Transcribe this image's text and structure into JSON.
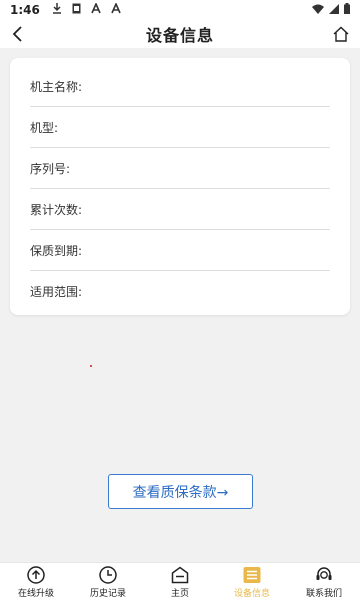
{
  "status_bar": {
    "time": "1:46",
    "icons": [
      "download-icon",
      "sim-icon",
      "a-icon",
      "a-icon"
    ],
    "right_icons": [
      "wifi-icon",
      "signal-icon",
      "battery-icon"
    ]
  },
  "header": {
    "title": "设备信息",
    "back_icon": "chevron-left-icon",
    "home_icon": "home-icon"
  },
  "device_info": {
    "rows": [
      {
        "label": "机主名称:",
        "value": ""
      },
      {
        "label": "机型:",
        "value": ""
      },
      {
        "label": "序列号:",
        "value": ""
      },
      {
        "label": "累计次数:",
        "value": ""
      },
      {
        "label": "保质到期:",
        "value": ""
      },
      {
        "label": "适用范围:",
        "value": ""
      }
    ]
  },
  "warranty_button": {
    "label": "查看质保条款→"
  },
  "tab_bar": {
    "items": [
      {
        "label": "在线升级",
        "icon": "upload-circle-icon",
        "active": false
      },
      {
        "label": "历史记录",
        "icon": "clock-icon",
        "active": false
      },
      {
        "label": "主页",
        "icon": "home-box-icon",
        "active": false
      },
      {
        "label": "设备信息",
        "icon": "list-icon",
        "active": true
      },
      {
        "label": "联系我们",
        "icon": "headset-icon",
        "active": false
      }
    ]
  },
  "colors": {
    "accent_active": "#e8b94a",
    "button_border": "#3b7bd0",
    "background": "#f1f1f1"
  }
}
